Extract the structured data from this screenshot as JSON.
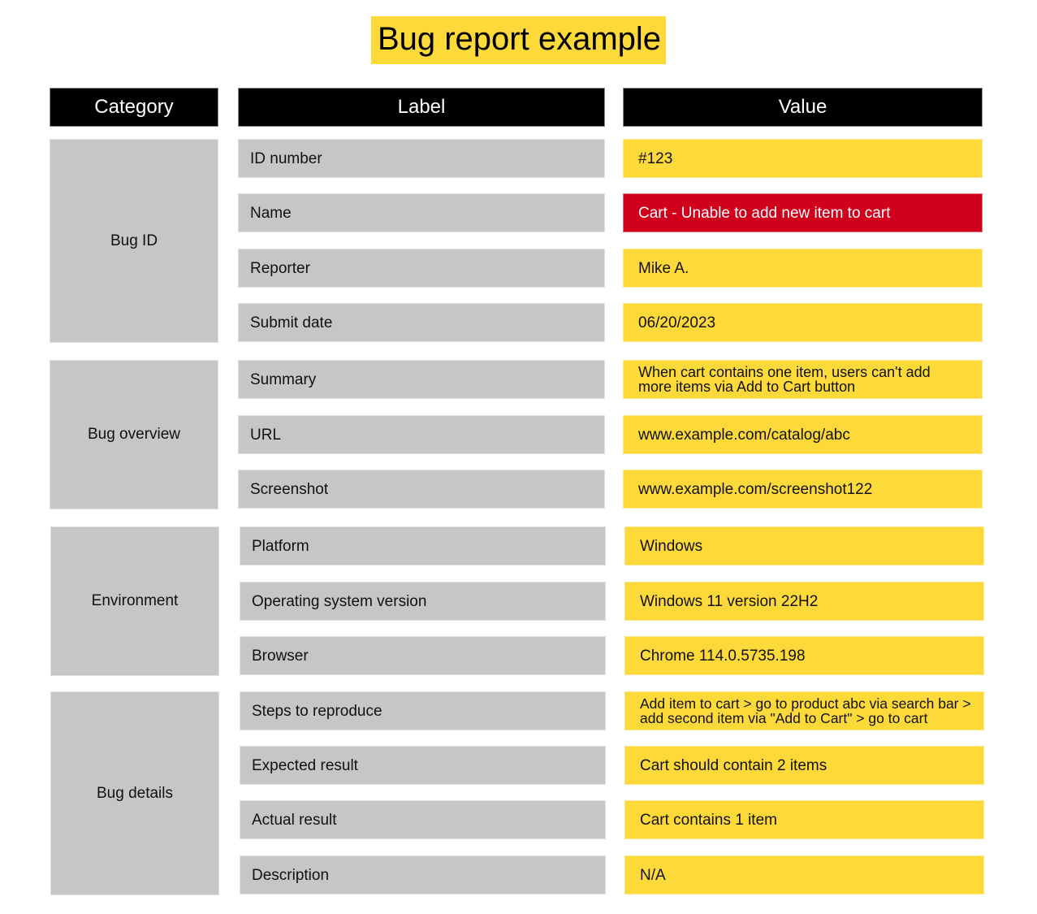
{
  "title": "Bug report example",
  "colors": {
    "header_bg": "#000000",
    "category_bg": "#c6c6c6",
    "label_bg": "#c6c6c6",
    "value_bg": "#fed93a",
    "highlight_bg": "#d0001c"
  },
  "headers": {
    "category": "Category",
    "label": "Label",
    "value": "Value"
  },
  "groups": [
    {
      "category": "Bug ID",
      "rows": [
        {
          "label": "ID number",
          "value": "#123"
        },
        {
          "label": "Name",
          "value": "Cart - Unable to add new item to cart",
          "highlight": true
        },
        {
          "label": "Reporter",
          "value": "Mike A."
        },
        {
          "label": "Submit date",
          "value": "06/20/2023"
        }
      ]
    },
    {
      "category": "Bug overview",
      "rows": [
        {
          "label": "Summary",
          "value": "When cart contains one item, users can't add more items via Add to Cart button"
        },
        {
          "label": "URL",
          "value": "www.example.com/catalog/abc"
        },
        {
          "label": "Screenshot",
          "value": "www.example.com/screenshot122"
        }
      ]
    },
    {
      "category": "Environment",
      "rows": [
        {
          "label": "Platform",
          "value": "Windows"
        },
        {
          "label": "Operating system version",
          "value": "Windows 11 version 22H2"
        },
        {
          "label": "Browser",
          "value": "Chrome 114.0.5735.198"
        }
      ]
    },
    {
      "category": "Bug details",
      "rows": [
        {
          "label": "Steps to reproduce",
          "value": "Add item to cart > go to product abc via search bar > add second item via \"Add to Cart\" > go to cart"
        },
        {
          "label": "Expected result",
          "value": "Cart should contain 2 items"
        },
        {
          "label": "Actual result",
          "value": "Cart contains 1 item"
        },
        {
          "label": "Description",
          "value": "N/A"
        }
      ]
    }
  ]
}
